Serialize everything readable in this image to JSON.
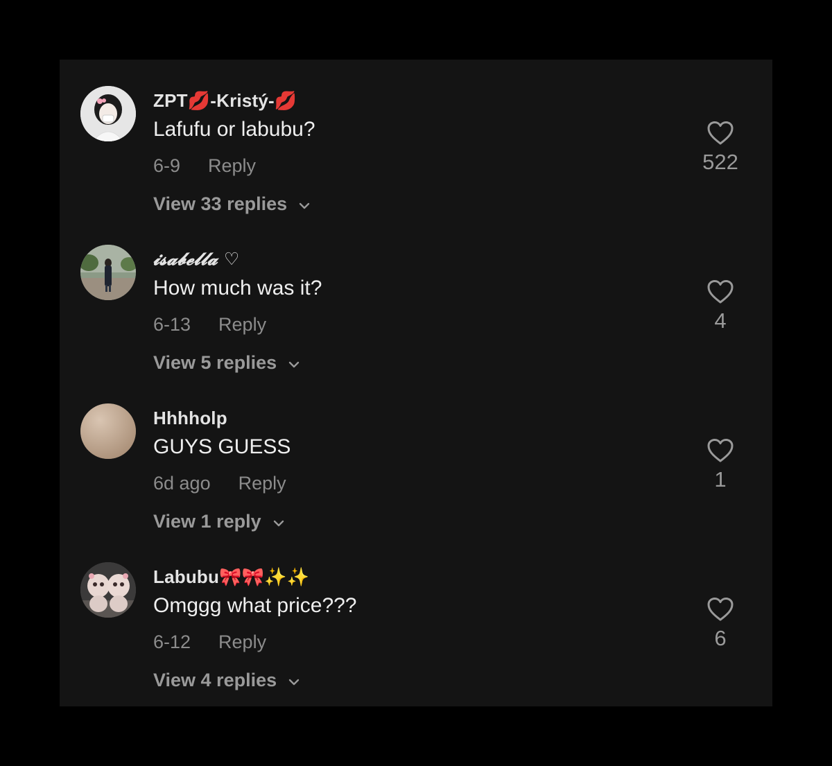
{
  "comments": [
    {
      "username": "ZPT💋-Kristý-💋",
      "avatar_icon": "avatar-girl-bow",
      "text": "Lafufu or labubu?",
      "date": "6-9",
      "reply_label": "Reply",
      "view_replies": "View 33 replies",
      "likes": "522"
    },
    {
      "username": "𝓲𝓼𝓪𝓫𝓮𝓵𝓵𝓪 ♡",
      "avatar_icon": "avatar-outdoor-photo",
      "text": "How much was it?",
      "date": "6-13",
      "reply_label": "Reply",
      "view_replies": "View 5 replies",
      "likes": "4"
    },
    {
      "username": "Hhhholp",
      "avatar_icon": "avatar-beige",
      "text": "GUYS GUESS",
      "date": "6d ago",
      "reply_label": "Reply",
      "view_replies": "View 1 reply",
      "likes": "1"
    },
    {
      "username": "Labubu🎀🎀✨✨",
      "avatar_icon": "avatar-plush-toys",
      "text": "Omggg what price???",
      "date": "6-12",
      "reply_label": "Reply",
      "view_replies": "View 4 replies",
      "likes": "6"
    }
  ],
  "colors": {
    "background": "#000000",
    "panel": "#141414",
    "primary_text": "#efefef",
    "secondary_text": "#8c8c8c"
  }
}
